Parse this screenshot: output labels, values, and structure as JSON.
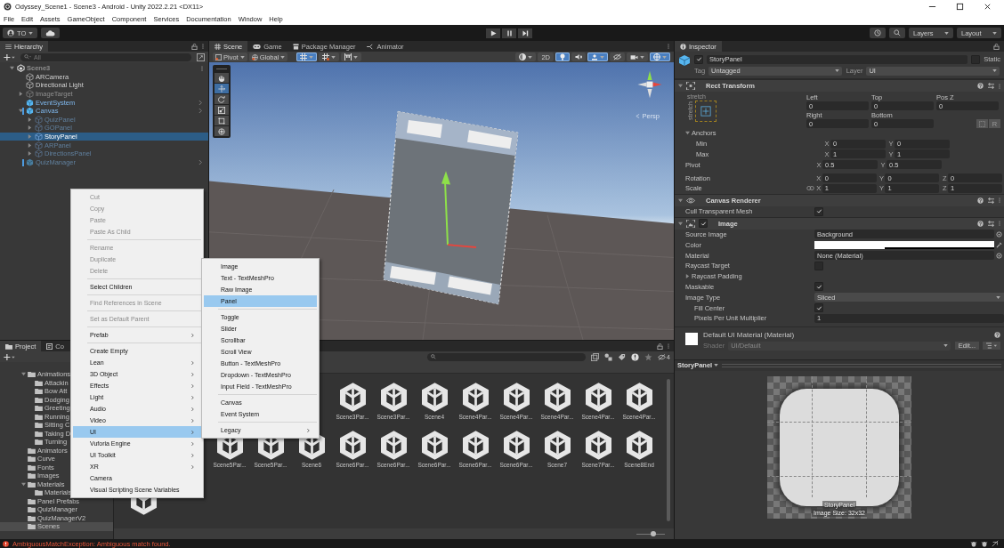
{
  "window": {
    "title": "Odyssey_Scene1 - Scene3 - Android - Unity 2022.2.21 <DX11>"
  },
  "menu_bar": [
    "File",
    "Edit",
    "Assets",
    "GameObject",
    "Component",
    "Services",
    "Documentation",
    "Window",
    "Help"
  ],
  "toolbar": {
    "account": "TO",
    "layers": "Layers",
    "layout": "Layout"
  },
  "hierarchy": {
    "tab": "Hierarchy",
    "search_placeholder": "All",
    "items": [
      {
        "label": "Scene3",
        "kind": "scene",
        "selected": false,
        "expanded": true,
        "children": [
          {
            "label": "ARCamera",
            "kind": "object",
            "active": true,
            "selected": false
          },
          {
            "label": "Directional Light",
            "kind": "object",
            "active": true,
            "selected": false
          },
          {
            "label": "ImageTarget",
            "kind": "object",
            "active": false,
            "selected": false,
            "expanded": false
          },
          {
            "label": "EventSystem",
            "kind": "prefab",
            "active": true,
            "selected": false,
            "modified": false
          },
          {
            "label": "Canvas",
            "kind": "prefab",
            "active": true,
            "selected": false,
            "modified": true,
            "expanded": true,
            "children": [
              {
                "label": "QuizPanel",
                "kind": "prefab_part",
                "active": false,
                "selected": false,
                "expanded": false
              },
              {
                "label": "GOPanel",
                "kind": "prefab_part",
                "active": false,
                "selected": false,
                "expanded": false
              },
              {
                "label": "StoryPanel",
                "kind": "prefab_part",
                "active": true,
                "selected": true,
                "expanded": false
              },
              {
                "label": "ARPanel",
                "kind": "prefab_part",
                "active": false,
                "selected": false,
                "expanded": false
              },
              {
                "label": "DirectionsPanel",
                "kind": "prefab_part",
                "active": false,
                "selected": false,
                "expanded": false
              }
            ]
          },
          {
            "label": "QuizManager",
            "kind": "prefab",
            "active": false,
            "selected": false,
            "modified": true
          }
        ]
      }
    ]
  },
  "scene_view": {
    "tabs": [
      {
        "label": "Scene",
        "kind": "scene",
        "selected": true
      },
      {
        "label": "Game",
        "kind": "game",
        "selected": false
      },
      {
        "label": "Package Manager",
        "kind": "package",
        "selected": false
      },
      {
        "label": "Animator",
        "kind": "animator",
        "selected": false
      }
    ],
    "pivot": "Pivot",
    "space": "Global",
    "snap_buttons": [
      {
        "kind": "grid",
        "on": true
      },
      {
        "kind": "increment",
        "on": false
      },
      {
        "kind": "ruler",
        "on": false
      }
    ],
    "view_buttons": [
      {
        "kind": "shading",
        "on": false
      },
      {
        "kind": "mode2d",
        "label": "2D",
        "on": false
      },
      {
        "kind": "lighting",
        "on": true
      },
      {
        "kind": "audio",
        "on": false
      },
      {
        "kind": "effects",
        "on": true
      },
      {
        "kind": "visibility",
        "on": false
      },
      {
        "kind": "camera",
        "on": false
      },
      {
        "kind": "gizmos",
        "on": true
      }
    ],
    "tools": [
      {
        "kind": "hand",
        "selected": false
      },
      {
        "kind": "move",
        "selected": true
      },
      {
        "kind": "rotate",
        "selected": false
      },
      {
        "kind": "scale",
        "selected": false
      },
      {
        "kind": "rect",
        "selected": false
      },
      {
        "kind": "transform",
        "selected": false
      }
    ],
    "projection": "Persp"
  },
  "project": {
    "tabs": [
      {
        "label": "Project",
        "selected": true
      },
      {
        "label": "Co",
        "selected": false
      }
    ],
    "folders": [
      {
        "label": "Animations",
        "expanded": true,
        "selected": false,
        "children": [
          {
            "label": "Attackin",
            "selected": false
          },
          {
            "label": "Bow Att",
            "selected": false
          },
          {
            "label": "Dodging",
            "selected": false
          },
          {
            "label": "Greeting",
            "selected": false
          },
          {
            "label": "Running",
            "selected": false
          },
          {
            "label": "Sitting C",
            "selected": false
          },
          {
            "label": "Taking D",
            "selected": false
          },
          {
            "label": "Turning",
            "selected": false
          }
        ]
      },
      {
        "label": "Animators",
        "selected": false
      },
      {
        "label": "Curve",
        "selected": false
      },
      {
        "label": "Fonts",
        "selected": false
      },
      {
        "label": "Images",
        "selected": false
      },
      {
        "label": "Materials",
        "expanded": true,
        "selected": false,
        "children": [
          {
            "label": "Materials",
            "selected": false
          }
        ]
      },
      {
        "label": "Panel Prefabs",
        "selected": false
      },
      {
        "label": "QuizManager",
        "selected": false
      },
      {
        "label": "QuizManagerV2",
        "selected": false
      },
      {
        "label": "Scenes",
        "selected": true
      }
    ],
    "hidden_count": "4",
    "asset_rows": [
      [
        "Scene3Par...",
        "Scene3Par...",
        "Scene4",
        "Scene4Par...",
        "Scene4Par...",
        "Scene4Par...",
        "Scene4Par...",
        "Scene4Par..."
      ],
      [
        "Scene5Par...",
        "Scene5Par...",
        "Scene6",
        "Scene6Par...",
        "Scene6Par...",
        "Scene6Par...",
        "Scene6Par...",
        "Scene6Par...",
        "Scene7",
        "Scene7Par...",
        "Scene8End"
      ]
    ],
    "zoom": {
      "level": 0.6
    }
  },
  "context_menu": {
    "items": [
      {
        "kind": "item",
        "label": "Cut",
        "disabled": true,
        "submenu": false,
        "selected": false
      },
      {
        "kind": "item",
        "label": "Copy",
        "disabled": true,
        "submenu": false,
        "selected": false
      },
      {
        "kind": "item",
        "label": "Paste",
        "disabled": true,
        "submenu": false,
        "selected": false
      },
      {
        "kind": "item",
        "label": "Paste As Child",
        "disabled": true,
        "submenu": false,
        "selected": false
      },
      {
        "kind": "separator"
      },
      {
        "kind": "item",
        "label": "Rename",
        "disabled": true,
        "submenu": false,
        "selected": false
      },
      {
        "kind": "item",
        "label": "Duplicate",
        "disabled": true,
        "submenu": false,
        "selected": false
      },
      {
        "kind": "item",
        "label": "Delete",
        "disabled": true,
        "submenu": false,
        "selected": false
      },
      {
        "kind": "separator"
      },
      {
        "kind": "item",
        "label": "Select Children",
        "disabled": false,
        "submenu": false,
        "selected": false
      },
      {
        "kind": "separator"
      },
      {
        "kind": "item",
        "label": "Find References in Scene",
        "disabled": true,
        "submenu": false,
        "selected": false
      },
      {
        "kind": "separator"
      },
      {
        "kind": "item",
        "label": "Set as Default Parent",
        "disabled": true,
        "submenu": false,
        "selected": false
      },
      {
        "kind": "separator"
      },
      {
        "kind": "item",
        "label": "Prefab",
        "disabled": false,
        "submenu": true,
        "selected": false
      },
      {
        "kind": "separator"
      },
      {
        "kind": "item",
        "label": "Create Empty",
        "disabled": false,
        "submenu": false,
        "selected": false
      },
      {
        "kind": "item",
        "label": "Lean",
        "disabled": false,
        "submenu": true,
        "selected": false
      },
      {
        "kind": "item",
        "label": "3D Object",
        "disabled": false,
        "submenu": true,
        "selected": false
      },
      {
        "kind": "item",
        "label": "Effects",
        "disabled": false,
        "submenu": true,
        "selected": false
      },
      {
        "kind": "item",
        "label": "Light",
        "disabled": false,
        "submenu": true,
        "selected": false
      },
      {
        "kind": "item",
        "label": "Audio",
        "disabled": false,
        "submenu": true,
        "selected": false
      },
      {
        "kind": "item",
        "label": "Video",
        "disabled": false,
        "submenu": true,
        "selected": false
      },
      {
        "kind": "item",
        "label": "UI",
        "disabled": false,
        "submenu": true,
        "selected": true
      },
      {
        "kind": "item",
        "label": "Vuforia Engine",
        "disabled": false,
        "submenu": true,
        "selected": false
      },
      {
        "kind": "item",
        "label": "UI Toolkit",
        "disabled": false,
        "submenu": true,
        "selected": false
      },
      {
        "kind": "item",
        "label": "XR",
        "disabled": false,
        "submenu": true,
        "selected": false
      },
      {
        "kind": "item",
        "label": "Camera",
        "disabled": false,
        "submenu": false,
        "selected": false
      },
      {
        "kind": "item",
        "label": "Visual Scripting Scene Variables",
        "disabled": false,
        "submenu": false,
        "selected": false
      }
    ]
  },
  "submenu": {
    "items": [
      {
        "kind": "item",
        "label": "Image",
        "submenu": false,
        "selected": false
      },
      {
        "kind": "item",
        "label": "Text - TextMeshPro",
        "submenu": false,
        "selected": false
      },
      {
        "kind": "item",
        "label": "Raw Image",
        "submenu": false,
        "selected": false
      },
      {
        "kind": "item",
        "label": "Panel",
        "submenu": false,
        "selected": true
      },
      {
        "kind": "separator"
      },
      {
        "kind": "item",
        "label": "Toggle",
        "submenu": false,
        "selected": false
      },
      {
        "kind": "item",
        "label": "Slider",
        "submenu": false,
        "selected": false
      },
      {
        "kind": "item",
        "label": "Scrollbar",
        "submenu": false,
        "selected": false
      },
      {
        "kind": "item",
        "label": "Scroll View",
        "submenu": false,
        "selected": false
      },
      {
        "kind": "item",
        "label": "Button - TextMeshPro",
        "submenu": false,
        "selected": false
      },
      {
        "kind": "item",
        "label": "Dropdown - TextMeshPro",
        "submenu": false,
        "selected": false
      },
      {
        "kind": "item",
        "label": "Input Field - TextMeshPro",
        "submenu": false,
        "selected": false
      },
      {
        "kind": "separator"
      },
      {
        "kind": "item",
        "label": "Canvas",
        "submenu": false,
        "selected": false
      },
      {
        "kind": "item",
        "label": "Event System",
        "submenu": false,
        "selected": false
      },
      {
        "kind": "separator"
      },
      {
        "kind": "item",
        "label": "Legacy",
        "submenu": true,
        "selected": false
      }
    ]
  },
  "inspector": {
    "tab": "Inspector",
    "object": {
      "active": true,
      "name": "StoryPanel",
      "static": false,
      "static_label": "Static",
      "tag_label": "Tag",
      "tag": "Untagged",
      "layer_label": "Layer",
      "layer": "UI"
    },
    "rect_transform": {
      "title": "Rect Transform",
      "expanded": true,
      "preset_top": "stretch",
      "preset_side": "stretch",
      "position_rows": [
        [
          {
            "label": "Left",
            "value": "0"
          },
          {
            "label": "Top",
            "value": "0"
          },
          {
            "label": "Pos Z",
            "value": "0"
          }
        ],
        [
          {
            "label": "Right",
            "value": "0"
          },
          {
            "label": "Bottom",
            "value": "0"
          }
        ]
      ],
      "raw_button": "R",
      "anchors": {
        "label": "Anchors",
        "expanded": true,
        "rows": [
          {
            "label": "Min",
            "axes": [
              {
                "axis": "X",
                "value": "0"
              },
              {
                "axis": "Y",
                "value": "0"
              }
            ]
          },
          {
            "label": "Max",
            "axes": [
              {
                "axis": "X",
                "value": "1"
              },
              {
                "axis": "Y",
                "value": "1"
              }
            ]
          }
        ]
      },
      "rows": [
        {
          "label": "Pivot",
          "linked": false,
          "axes": [
            {
              "axis": "X",
              "value": "0.5"
            },
            {
              "axis": "Y",
              "value": "0.5"
            }
          ]
        },
        {
          "label": "Rotation",
          "linked": false,
          "axes": [
            {
              "axis": "X",
              "value": "0"
            },
            {
              "axis": "Y",
              "value": "0"
            },
            {
              "axis": "Z",
              "value": "0"
            }
          ]
        },
        {
          "label": "Scale",
          "linked": true,
          "axes": [
            {
              "axis": "X",
              "value": "1"
            },
            {
              "axis": "Y",
              "value": "1"
            },
            {
              "axis": "Z",
              "value": "1"
            }
          ]
        }
      ]
    },
    "canvas_renderer": {
      "title": "Canvas Renderer",
      "expanded": true,
      "rows": [
        {
          "kind": "checkbox",
          "label": "Cull Transparent Mesh",
          "checked": true
        }
      ]
    },
    "image": {
      "title": "Image",
      "expanded": true,
      "enabled": true,
      "rows": [
        {
          "kind": "object",
          "label": "Source Image",
          "value": "Background"
        },
        {
          "kind": "color",
          "label": "Color",
          "color": "#ffffff",
          "level": 0.39
        },
        {
          "kind": "object",
          "label": "Material",
          "value": "None (Material)"
        },
        {
          "kind": "checkbox",
          "label": "Raycast Target",
          "checked": false
        },
        {
          "kind": "foldout",
          "label": "Raycast Padding",
          "expanded": false
        },
        {
          "kind": "checkbox",
          "label": "Maskable",
          "checked": true
        },
        {
          "kind": "dropdown",
          "label": "Image Type",
          "value": "Sliced",
          "children": [
            {
              "kind": "checkbox",
              "label": "Fill Center",
              "checked": true
            },
            {
              "kind": "number",
              "label": "Pixels Per Unit Multiplier",
              "value": "1"
            }
          ]
        }
      ]
    },
    "material": {
      "name": "Default UI Material (Material)",
      "shader_label": "Shader",
      "shader": "UI/Default",
      "edit_button": "Edit..."
    },
    "preview": {
      "title": "StoryPanel",
      "name": "StoryPanel",
      "size": "Image Size: 32x32"
    }
  },
  "status_bar": {
    "message": "AmbiguousMatchException: Ambiguous match found."
  }
}
